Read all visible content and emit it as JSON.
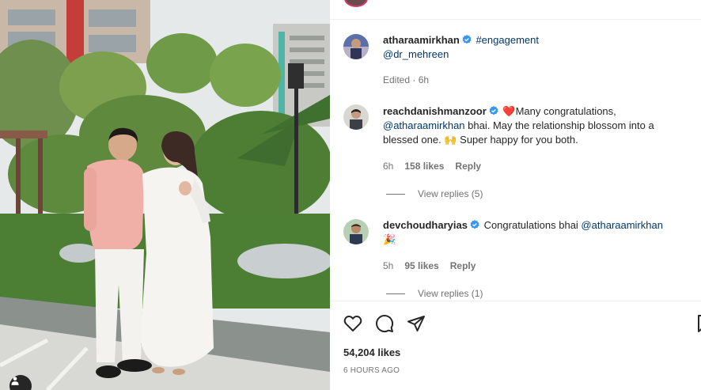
{
  "post": {
    "caption": {
      "username": "atharaamirkhan",
      "hashtag": "#engagement",
      "mention": "@dr_mehreen",
      "meta": "Edited · 6h"
    },
    "comments": [
      {
        "username": "reachdanishmanzoor",
        "emoji_lead": "❤️",
        "text_a": "Many congratulations,",
        "mention": "@atharaamirkhan",
        "text_b": " bhai. May the relationship blossom into a blessed one. ",
        "emoji_mid": "🙌",
        "text_c": " Super happy for you both.",
        "time": "6h",
        "likes": "158 likes",
        "reply_label": "Reply",
        "view_replies": "View replies (5)"
      },
      {
        "username": "devchoudharyias",
        "text_a": "Congratulations bhai ",
        "mention": "@atharaamirkhan",
        "emoji_end": "🎉",
        "time": "5h",
        "likes": "95 likes",
        "reply_label": "Reply",
        "view_replies": "View replies (1)"
      }
    ],
    "likes": "54,204 likes",
    "date": "6 HOURS AGO"
  },
  "icons": {
    "like": "heart-icon",
    "comment": "comment-icon",
    "share": "share-icon",
    "save": "bookmark-icon",
    "verified": "verified-badge-icon",
    "tag": "user-tag-icon"
  },
  "colors": {
    "verified_blue": "#3897f0",
    "link": "#00376b",
    "secondary_text": "#737373",
    "heart_red": "#ed4956"
  }
}
